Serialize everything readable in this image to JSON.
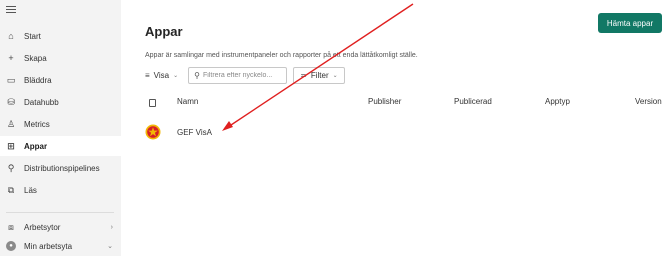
{
  "sidebar": {
    "items": [
      {
        "label": "Start",
        "icon": "home-icon"
      },
      {
        "label": "Skapa",
        "icon": "plus-icon"
      },
      {
        "label": "Bläddra",
        "icon": "folder-icon"
      },
      {
        "label": "Datahubb",
        "icon": "database-icon"
      },
      {
        "label": "Metrics",
        "icon": "trophy-icon"
      },
      {
        "label": "Appar",
        "icon": "apps-icon",
        "active": true
      },
      {
        "label": "Distributionspipelines",
        "icon": "rocket-icon"
      },
      {
        "label": "Läs",
        "icon": "book-icon"
      }
    ],
    "workspaces": {
      "label": "Arbetsytor"
    },
    "my_workspace": {
      "label": "Min arbetsyta"
    }
  },
  "main": {
    "title": "Appar",
    "get_apps_button": "Hämta appar",
    "description": "Appar är samlingar med instrumentpaneler och rapporter på ett enda lättåtkomligt ställe.",
    "toolbar": {
      "view_label": "Visa",
      "search_placeholder": "Filtrera efter nyckelo...",
      "filter_label": "Filter"
    },
    "table": {
      "columns": [
        "Namn",
        "Publisher",
        "Publicerad",
        "Apptyp",
        "Version"
      ],
      "rows": [
        {
          "name": "GEF VisA",
          "publisher": "",
          "published": "",
          "app_type": "",
          "version": ""
        }
      ]
    }
  },
  "colors": {
    "accent": "#117865",
    "sidebar_bg": "#f3f3f3",
    "arrow": "#e02020"
  }
}
